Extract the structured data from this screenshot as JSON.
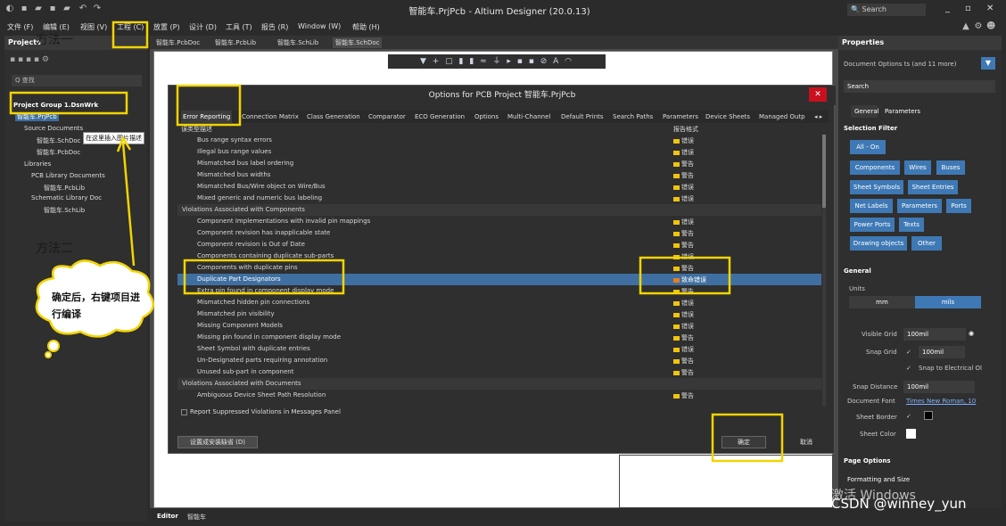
{
  "window": {
    "title": "智能车.PrjPcb - Altium Designer (20.0.13)",
    "search_label": "Search"
  },
  "menu": [
    "文件 (F)",
    "编辑 (E)",
    "视图 (V)",
    "工程 (C)",
    "放置 (P)",
    "设计 (D)",
    "工具 (T)",
    "报告 (R)",
    "Window (W)",
    "帮助 (H)"
  ],
  "projects_panel": {
    "title": "Projects",
    "search": "Q 查找",
    "tree": [
      "Project Group 1.DsnWrk",
      "智能车.PrjPcb",
      "Source Documents",
      "智能车.SchDoc",
      "智能车.PcbDoc",
      "Libraries",
      "PCB Library Documents",
      "智能车.PcbLib",
      "Schematic Library Doc",
      "智能车.SchLib"
    ]
  },
  "doc_tabs": [
    "智能车.PcbDoc",
    "智能车.PcbLib",
    "智能车.SchLib",
    "智能车.SchDoc"
  ],
  "annotations": {
    "method1": "方法一",
    "method2": "方法二",
    "callout": "在这里插入图片描述",
    "cloud": "确定后，右键项目进行编译"
  },
  "dialog": {
    "title": "Options for PCB Project 智能车.PrjPcb",
    "close": "✕",
    "tabs": [
      "Error Reporting",
      "Connection Matrix",
      "Class Generation",
      "Comparator",
      "ECO Generation",
      "Options",
      "Multi-Channel",
      "Default Prints",
      "Search Paths",
      "Parameters",
      "Device Sheets",
      "Managed Outp"
    ],
    "col_type": "误类型描述",
    "col_mode": "报告格式",
    "rows": [
      {
        "desc": "Bus range syntax errors",
        "sev": "错误",
        "kind": "item"
      },
      {
        "desc": "Illegal bus range values",
        "sev": "错误",
        "kind": "item"
      },
      {
        "desc": "Mismatched bus label ordering",
        "sev": "警告",
        "kind": "item"
      },
      {
        "desc": "Mismatched bus widths",
        "sev": "警告",
        "kind": "item"
      },
      {
        "desc": "Mismatched Bus/Wire object on Wire/Bus",
        "sev": "错误",
        "kind": "item"
      },
      {
        "desc": "Mixed generic and numeric bus labeling",
        "sev": "错误",
        "kind": "item"
      },
      {
        "desc": "Violations Associated with Components",
        "sev": "",
        "kind": "group"
      },
      {
        "desc": "Component Implementations with invalid pin mappings",
        "sev": "错误",
        "kind": "item"
      },
      {
        "desc": "Component revision has inapplicable state",
        "sev": "警告",
        "kind": "item"
      },
      {
        "desc": "Component revision is Out of Date",
        "sev": "警告",
        "kind": "item"
      },
      {
        "desc": "Components containing duplicate sub-parts",
        "sev": "错误",
        "kind": "item"
      },
      {
        "desc": "Components with duplicate pins",
        "sev": "警告",
        "kind": "item"
      },
      {
        "desc": "Duplicate Part Designators",
        "sev": "致命错误",
        "kind": "selected"
      },
      {
        "desc": "Extra pin found in component display mode",
        "sev": "警告",
        "kind": "item"
      },
      {
        "desc": "Mismatched hidden pin connections",
        "sev": "错误",
        "kind": "item"
      },
      {
        "desc": "Mismatched pin visibility",
        "sev": "错误",
        "kind": "item"
      },
      {
        "desc": "Missing Component Models",
        "sev": "错误",
        "kind": "item"
      },
      {
        "desc": "Missing pin found in component display mode",
        "sev": "警告",
        "kind": "item"
      },
      {
        "desc": "Sheet Symbol with duplicate entries",
        "sev": "错误",
        "kind": "item"
      },
      {
        "desc": "Un-Designated parts requiring annotation",
        "sev": "警告",
        "kind": "item"
      },
      {
        "desc": "Unused sub-part in component",
        "sev": "警告",
        "kind": "item"
      },
      {
        "desc": "Violations Associated with Documents",
        "sev": "",
        "kind": "group"
      },
      {
        "desc": "Ambiguous Device Sheet Path Resolution",
        "sev": "警告",
        "kind": "item"
      }
    ],
    "report_suppressed": "Report Suppressed Violations in Messages Panel",
    "btn_default": "设置成安装缺省 (D)",
    "btn_ok": "确定",
    "btn_cancel": "取消"
  },
  "properties": {
    "title": "Properties",
    "doc_options": "Document Options  ts (and 11 more)",
    "search": "Search",
    "tab_general": "General",
    "tab_params": "Parameters",
    "selection_filter": "Selection Filter",
    "filter_buttons": [
      "All - On",
      "Components",
      "Wires",
      "Buses",
      "Sheet Symbols",
      "Sheet Entries",
      "Net Labels",
      "Parameters",
      "Ports",
      "Power Ports",
      "Texts",
      "Drawing objects",
      "Other"
    ],
    "general": "General",
    "units": "Units",
    "mm": "mm",
    "mils": "mils",
    "visible_grid": "Visible Grid",
    "visible_grid_val": "100mil",
    "snap_grid": "Snap Grid",
    "snap_grid_val": "100mil",
    "snap_electrical": "Snap to Electrical Ol",
    "snap_distance": "Snap Distance",
    "snap_distance_val": "100mil",
    "document_font": "Document Font",
    "document_font_val": "Times New Roman, 10",
    "sheet_border": "Sheet Border",
    "sheet_color": "Sheet Color",
    "page_options": "Page Options",
    "formatting": "Formatting and Size"
  },
  "status": {
    "editor": "Editor",
    "doc": "智能车"
  },
  "watermark": {
    "line1": "激活 Windows",
    "line2": "CSDN @winney_yun"
  }
}
